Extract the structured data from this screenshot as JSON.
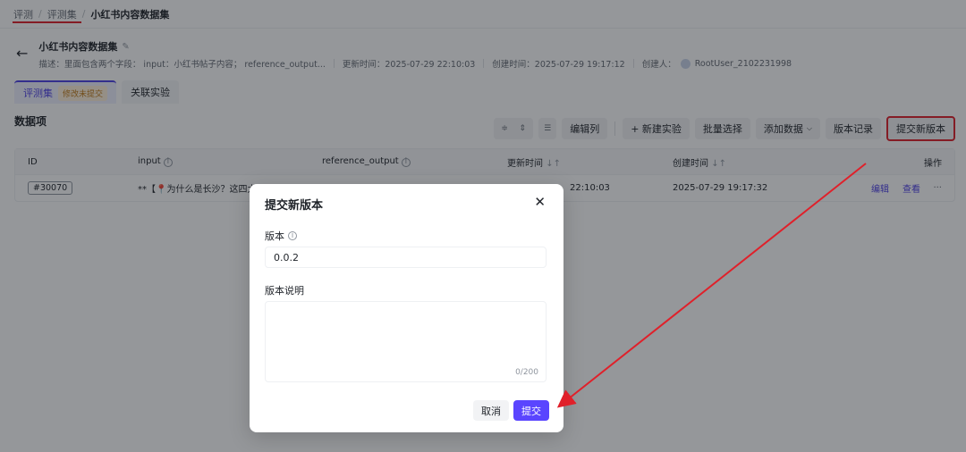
{
  "breadcrumb": [
    "评测",
    "评测集",
    "小红书内容数据集"
  ],
  "header": {
    "dataset_name": "小红书内容数据集",
    "description": "描述：里面包含两个字段： input：小红书帖子内容； reference_output...",
    "updated": "更新时间：2025-07-29 22:10:03",
    "created": "创建时间：2025-07-29 19:17:12",
    "creator_label": "创建人：",
    "creator": "RootUser_2102231998"
  },
  "tabs": [
    {
      "label": "评测集",
      "tag": "修改未提交"
    },
    {
      "label": "关联实验"
    }
  ],
  "toolbar": {
    "title": "数据项",
    "edit_columns": "编辑列",
    "new_experiment": "+ 新建实验",
    "batch_select": "批量选择",
    "add_data": "添加数据",
    "version_history": "版本记录",
    "submit_version": "提交新版本"
  },
  "table": {
    "columns": [
      "ID",
      "input",
      "reference_output",
      "更新时间",
      "创建时间",
      "操作"
    ],
    "rows": [
      {
        "id": "#30070",
        "input": "**【📍为什么是长沙？这四大",
        "updated": "22:10:03",
        "created": "2025-07-29 19:17:32",
        "edit": "编辑",
        "view": "查看",
        "more": "···"
      }
    ]
  },
  "modal": {
    "title": "提交新版本",
    "version_label": "版本",
    "version_value": "0.0.2",
    "desc_label": "版本说明",
    "counter": "0/200",
    "cancel": "取消",
    "submit": "提交"
  },
  "colors": {
    "accent": "#5a45ff",
    "annotation_red": "#e0202a"
  }
}
